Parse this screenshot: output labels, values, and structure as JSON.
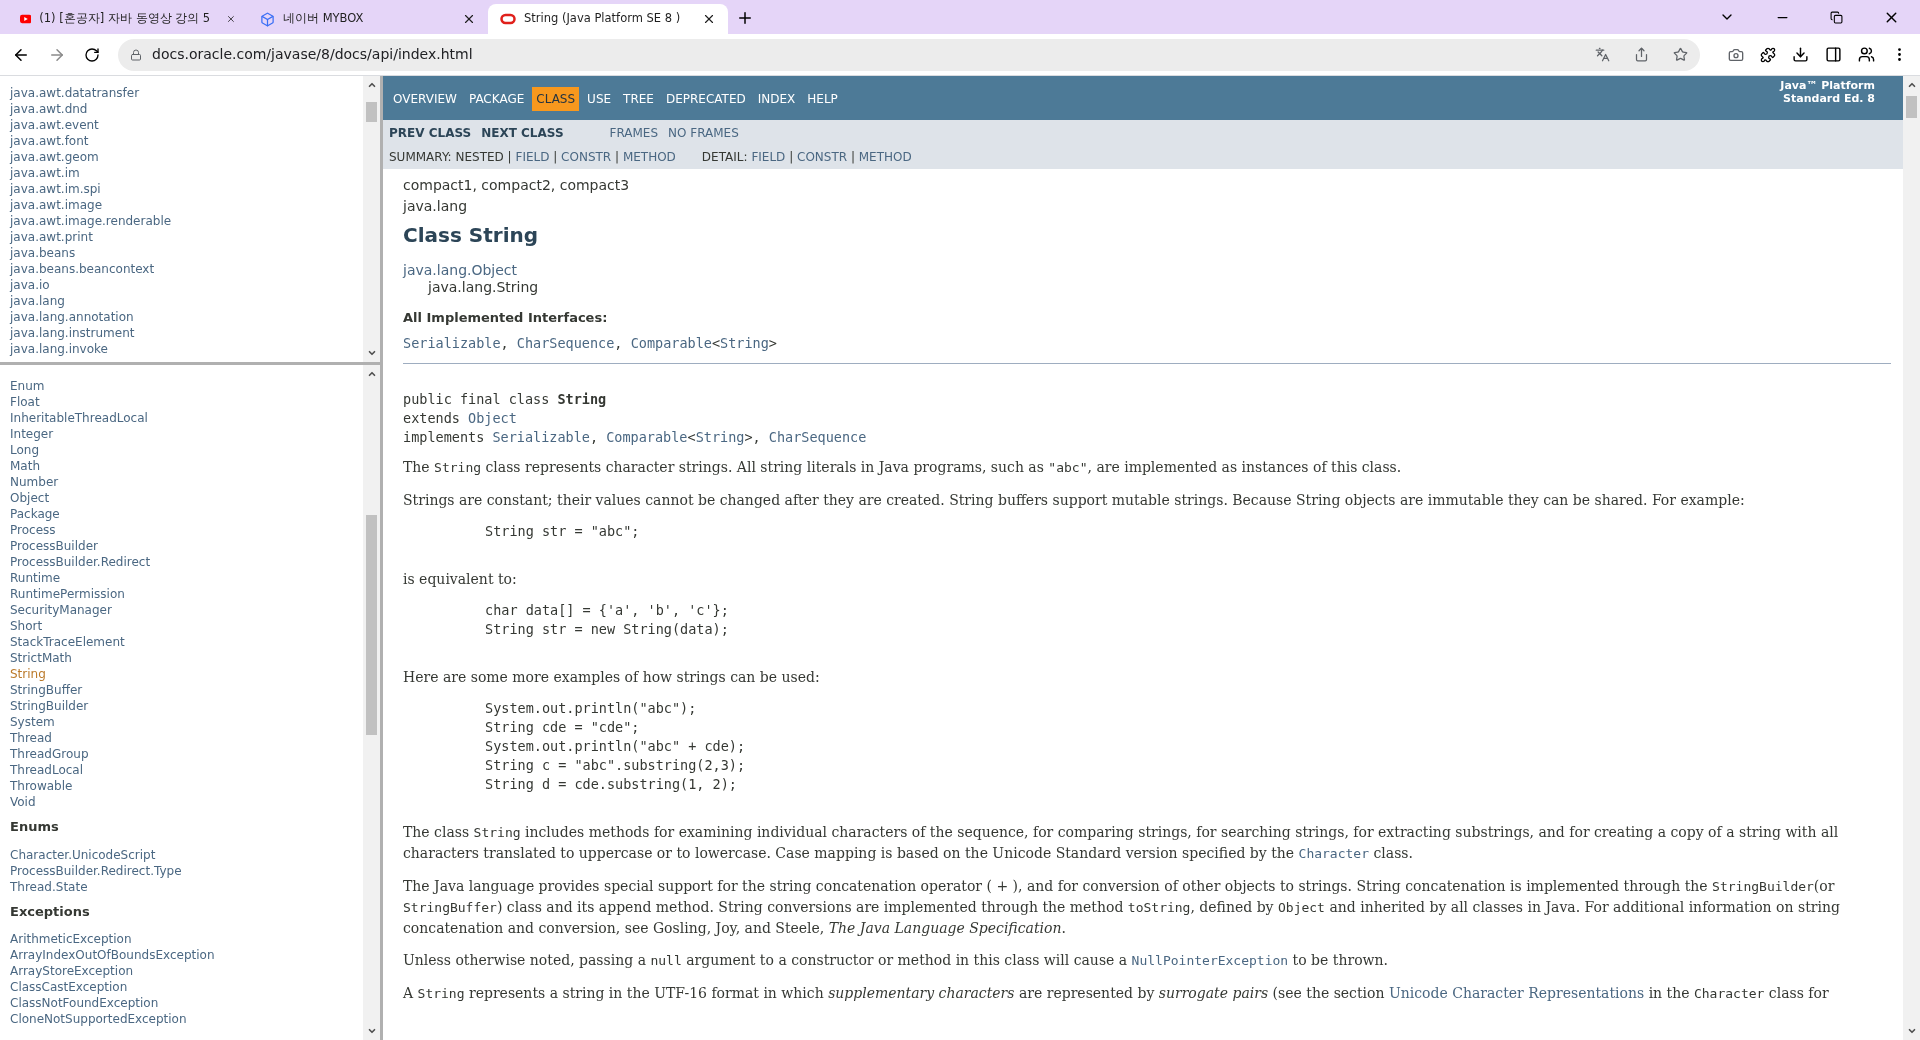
{
  "browser": {
    "tabs": [
      {
        "title": "(1) [혼공자] 자바 동영상 강의 5",
        "selected": false
      },
      {
        "title": "네이버 MYBOX",
        "selected": false
      },
      {
        "title": "String (Java Platform SE 8 )",
        "selected": true
      }
    ],
    "url": "docs.oracle.com/javase/8/docs/api/index.html"
  },
  "packages_frame": {
    "items": [
      "java.awt.datatransfer",
      "java.awt.dnd",
      "java.awt.event",
      "java.awt.font",
      "java.awt.geom",
      "java.awt.im",
      "java.awt.im.spi",
      "java.awt.image",
      "java.awt.image.renderable",
      "java.awt.print",
      "java.beans",
      "java.beans.beancontext",
      "java.io",
      "java.lang",
      "java.lang.annotation",
      "java.lang.instrument",
      "java.lang.invoke"
    ]
  },
  "classes_frame": {
    "sections": [
      {
        "items": [
          {
            "label": "Enum",
            "selected": false
          },
          {
            "label": "Float",
            "selected": false
          },
          {
            "label": "InheritableThreadLocal",
            "selected": false
          },
          {
            "label": "Integer",
            "selected": false
          },
          {
            "label": "Long",
            "selected": false
          },
          {
            "label": "Math",
            "selected": false
          },
          {
            "label": "Number",
            "selected": false
          },
          {
            "label": "Object",
            "selected": false
          },
          {
            "label": "Package",
            "selected": false
          },
          {
            "label": "Process",
            "selected": false
          },
          {
            "label": "ProcessBuilder",
            "selected": false
          },
          {
            "label": "ProcessBuilder.Redirect",
            "selected": false
          },
          {
            "label": "Runtime",
            "selected": false
          },
          {
            "label": "RuntimePermission",
            "selected": false
          },
          {
            "label": "SecurityManager",
            "selected": false
          },
          {
            "label": "Short",
            "selected": false
          },
          {
            "label": "StackTraceElement",
            "selected": false
          },
          {
            "label": "StrictMath",
            "selected": false
          },
          {
            "label": "String",
            "selected": true
          },
          {
            "label": "StringBuffer",
            "selected": false
          },
          {
            "label": "StringBuilder",
            "selected": false
          },
          {
            "label": "System",
            "selected": false
          },
          {
            "label": "Thread",
            "selected": false
          },
          {
            "label": "ThreadGroup",
            "selected": false
          },
          {
            "label": "ThreadLocal",
            "selected": false
          },
          {
            "label": "Throwable",
            "selected": false
          },
          {
            "label": "Void",
            "selected": false
          }
        ]
      },
      {
        "heading": "Enums",
        "items": [
          {
            "label": "Character.UnicodeScript",
            "selected": false
          },
          {
            "label": "ProcessBuilder.Redirect.Type",
            "selected": false
          },
          {
            "label": "Thread.State",
            "selected": false
          }
        ]
      },
      {
        "heading": "Exceptions",
        "items": [
          {
            "label": "ArithmeticException",
            "selected": false
          },
          {
            "label": "ArrayIndexOutOfBoundsException",
            "selected": false
          },
          {
            "label": "ArrayStoreException",
            "selected": false
          },
          {
            "label": "ClassCastException",
            "selected": false
          },
          {
            "label": "ClassNotFoundException",
            "selected": false
          },
          {
            "label": "CloneNotSupportedException",
            "selected": false
          }
        ]
      }
    ]
  },
  "nav": {
    "items": [
      {
        "label": "OVERVIEW",
        "selected": false
      },
      {
        "label": "PACKAGE",
        "selected": false
      },
      {
        "label": "CLASS",
        "selected": true
      },
      {
        "label": "USE",
        "selected": false
      },
      {
        "label": "TREE",
        "selected": false
      },
      {
        "label": "DEPRECATED",
        "selected": false
      },
      {
        "label": "INDEX",
        "selected": false
      },
      {
        "label": "HELP",
        "selected": false
      }
    ],
    "platform": [
      "Java™ Platform",
      "Standard Ed. 8"
    ]
  },
  "subnav": {
    "links": [
      "PREV CLASS",
      "NEXT CLASS"
    ],
    "frames": [
      "FRAMES",
      "NO FRAMES"
    ],
    "rows": [
      [
        {
          "kind": "text",
          "text": "SUMMARY: NESTED | "
        },
        {
          "kind": "link",
          "text": "FIELD"
        },
        {
          "kind": "text",
          "text": " | "
        },
        {
          "kind": "link",
          "text": "CONSTR"
        },
        {
          "kind": "text",
          "text": " | "
        },
        {
          "kind": "link",
          "text": "METHOD"
        }
      ],
      [
        {
          "kind": "text",
          "text": "DETAIL: "
        },
        {
          "kind": "link",
          "text": "FIELD"
        },
        {
          "kind": "text",
          "text": " | "
        },
        {
          "kind": "link",
          "text": "CONSTR"
        },
        {
          "kind": "text",
          "text": " | "
        },
        {
          "kind": "link",
          "text": "METHOD"
        }
      ]
    ]
  },
  "content": {
    "blocks": [
      {
        "kind": "label",
        "text": "compact1, compact2, compact3"
      },
      {
        "kind": "label",
        "text": "java.lang"
      },
      {
        "kind": "title",
        "text": "Class String"
      },
      {
        "kind": "inheritance",
        "parent": "java.lang.Object",
        "child": "java.lang.String"
      },
      {
        "kind": "subtitle",
        "text": "All Implemented Interfaces:"
      },
      {
        "kind": "mono",
        "lines": [
          [
            {
              "kind": "link",
              "text": "Serializable"
            },
            {
              "kind": "text",
              "text": ", "
            },
            {
              "kind": "link",
              "text": "CharSequence"
            },
            {
              "kind": "text",
              "text": ", "
            },
            {
              "kind": "link",
              "text": "Comparable"
            },
            {
              "kind": "text",
              "text": "<"
            },
            {
              "kind": "link",
              "text": "String"
            },
            {
              "kind": "text",
              "text": ">"
            }
          ]
        ]
      },
      {
        "kind": "rule"
      },
      {
        "kind": "mono",
        "lines": [
          [
            {
              "kind": "text",
              "text": "public final class "
            },
            {
              "kind": "bold",
              "text": "String"
            }
          ],
          [
            {
              "kind": "text",
              "text": "extends "
            },
            {
              "kind": "link",
              "text": "Object"
            }
          ],
          [
            {
              "kind": "text",
              "text": "implements "
            },
            {
              "kind": "link",
              "text": "Serializable"
            },
            {
              "kind": "text",
              "text": ", "
            },
            {
              "kind": "link",
              "text": "Comparable"
            },
            {
              "kind": "text",
              "text": "<"
            },
            {
              "kind": "link",
              "text": "String"
            },
            {
              "kind": "text",
              "text": ">, "
            },
            {
              "kind": "link",
              "text": "CharSequence"
            }
          ]
        ]
      },
      {
        "kind": "paragraph",
        "segments": [
          {
            "kind": "text",
            "text": "The "
          },
          {
            "kind": "code",
            "text": "String"
          },
          {
            "kind": "text",
            "text": " class represents character strings. All string literals in Java programs, such as "
          },
          {
            "kind": "code",
            "text": "\"abc\""
          },
          {
            "kind": "text",
            "text": ", are implemented as instances of this class."
          }
        ]
      },
      {
        "kind": "paragraph",
        "segments": [
          {
            "kind": "text",
            "text": "Strings are constant; their values cannot be changed after they are created. String buffers support mutable strings. Because String objects are immutable they can be shared. For example:"
          }
        ]
      },
      {
        "kind": "code_block",
        "lines": [
          "String str = \"abc\";"
        ]
      },
      {
        "kind": "paragraph",
        "segments": [
          {
            "kind": "text",
            "text": "is equivalent to:"
          }
        ]
      },
      {
        "kind": "code_block",
        "lines": [
          "char data[] = {'a', 'b', 'c'};",
          "String str = new String(data);"
        ]
      },
      {
        "kind": "paragraph",
        "segments": [
          {
            "kind": "text",
            "text": "Here are some more examples of how strings can be used:"
          }
        ]
      },
      {
        "kind": "code_block",
        "lines": [
          "System.out.println(\"abc\");",
          "String cde = \"cde\";",
          "System.out.println(\"abc\" + cde);",
          "String c = \"abc\".substring(2,3);",
          "String d = cde.substring(1, 2);"
        ]
      },
      {
        "kind": "paragraph",
        "segments": [
          {
            "kind": "text",
            "text": "The class "
          },
          {
            "kind": "code",
            "text": "String"
          },
          {
            "kind": "text",
            "text": " includes methods for examining individual characters of the sequence, for comparing strings, for searching strings, for extracting substrings, and for creating a copy of a string with all characters translated to uppercase or to lowercase. Case mapping is based on the Unicode Standard version specified by the "
          },
          {
            "kind": "code_link",
            "text": "Character"
          },
          {
            "kind": "text",
            "text": " class."
          }
        ]
      },
      {
        "kind": "paragraph",
        "segments": [
          {
            "kind": "text",
            "text": "The Java language provides special support for the string concatenation operator ( + ), and for conversion of other objects to strings. String concatenation is implemented through the "
          },
          {
            "kind": "code",
            "text": "StringBuilder"
          },
          {
            "kind": "text",
            "text": "(or "
          },
          {
            "kind": "code",
            "text": "StringBuffer"
          },
          {
            "kind": "text",
            "text": ") class and its append method. String conversions are implemented through the method "
          },
          {
            "kind": "code",
            "text": "toString"
          },
          {
            "kind": "text",
            "text": ", defined by "
          },
          {
            "kind": "code",
            "text": "Object"
          },
          {
            "kind": "text",
            "text": " and inherited by all classes in Java. For additional information on string concatenation and conversion, see Gosling, Joy, and Steele, "
          },
          {
            "kind": "italic",
            "text": "The Java Language Specification"
          },
          {
            "kind": "text",
            "text": "."
          }
        ]
      },
      {
        "kind": "paragraph",
        "segments": [
          {
            "kind": "text",
            "text": "Unless otherwise noted, passing a "
          },
          {
            "kind": "code",
            "text": "null"
          },
          {
            "kind": "text",
            "text": " argument to a constructor or method in this class will cause a "
          },
          {
            "kind": "code_link",
            "text": "NullPointerException"
          },
          {
            "kind": "text",
            "text": " to be thrown."
          }
        ]
      },
      {
        "kind": "paragraph",
        "segments": [
          {
            "kind": "text",
            "text": "A "
          },
          {
            "kind": "code",
            "text": "String"
          },
          {
            "kind": "text",
            "text": " represents a string in the UTF-16 format in which "
          },
          {
            "kind": "italic",
            "text": "supplementary characters"
          },
          {
            "kind": "text",
            "text": " are represented by "
          },
          {
            "kind": "italic",
            "text": "surrogate pairs"
          },
          {
            "kind": "text",
            "text": " (see the section "
          },
          {
            "kind": "link",
            "text": "Unicode Character Representations"
          },
          {
            "kind": "text",
            "text": " in the "
          },
          {
            "kind": "code",
            "text": "Character"
          },
          {
            "kind": "text",
            "text": " class for"
          }
        ]
      }
    ]
  }
}
